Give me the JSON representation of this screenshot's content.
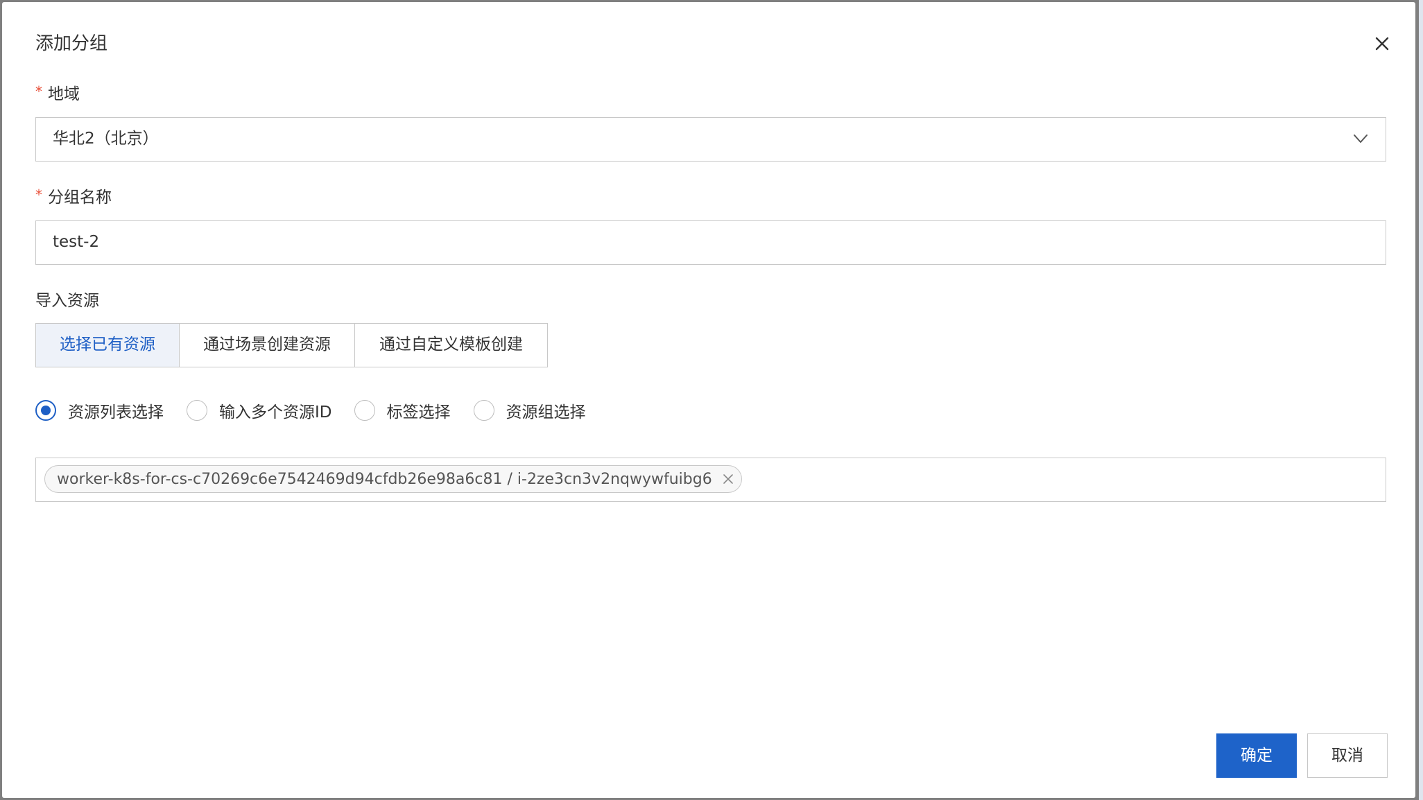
{
  "dialog": {
    "title": "添加分组",
    "close_icon": "close-icon"
  },
  "region": {
    "label": "地域",
    "required_mark": "*",
    "value": "华北2（北京）",
    "icon": "chevron-down-icon"
  },
  "group_name": {
    "label": "分组名称",
    "required_mark": "*",
    "value": "test-2"
  },
  "import_resources": {
    "label": "导入资源",
    "tabs": [
      {
        "label": "选择已有资源",
        "active": true
      },
      {
        "label": "通过场景创建资源",
        "active": false
      },
      {
        "label": "通过自定义模板创建",
        "active": false
      }
    ]
  },
  "selection_mode": {
    "options": [
      {
        "label": "资源列表选择",
        "checked": true
      },
      {
        "label": "输入多个资源ID",
        "checked": false
      },
      {
        "label": "标签选择",
        "checked": false
      },
      {
        "label": "资源组选择",
        "checked": false
      }
    ]
  },
  "selected_resources": [
    {
      "label": "worker-k8s-for-cs-c70269c6e7542469d94cfdb26e98a6c81 / i-2ze3cn3v2nqwywfuibg6"
    }
  ],
  "footer": {
    "confirm_label": "确定",
    "cancel_label": "取消"
  },
  "colors": {
    "accent": "#1e63c9",
    "required": "#e8503a",
    "border": "#c8c8c8"
  }
}
